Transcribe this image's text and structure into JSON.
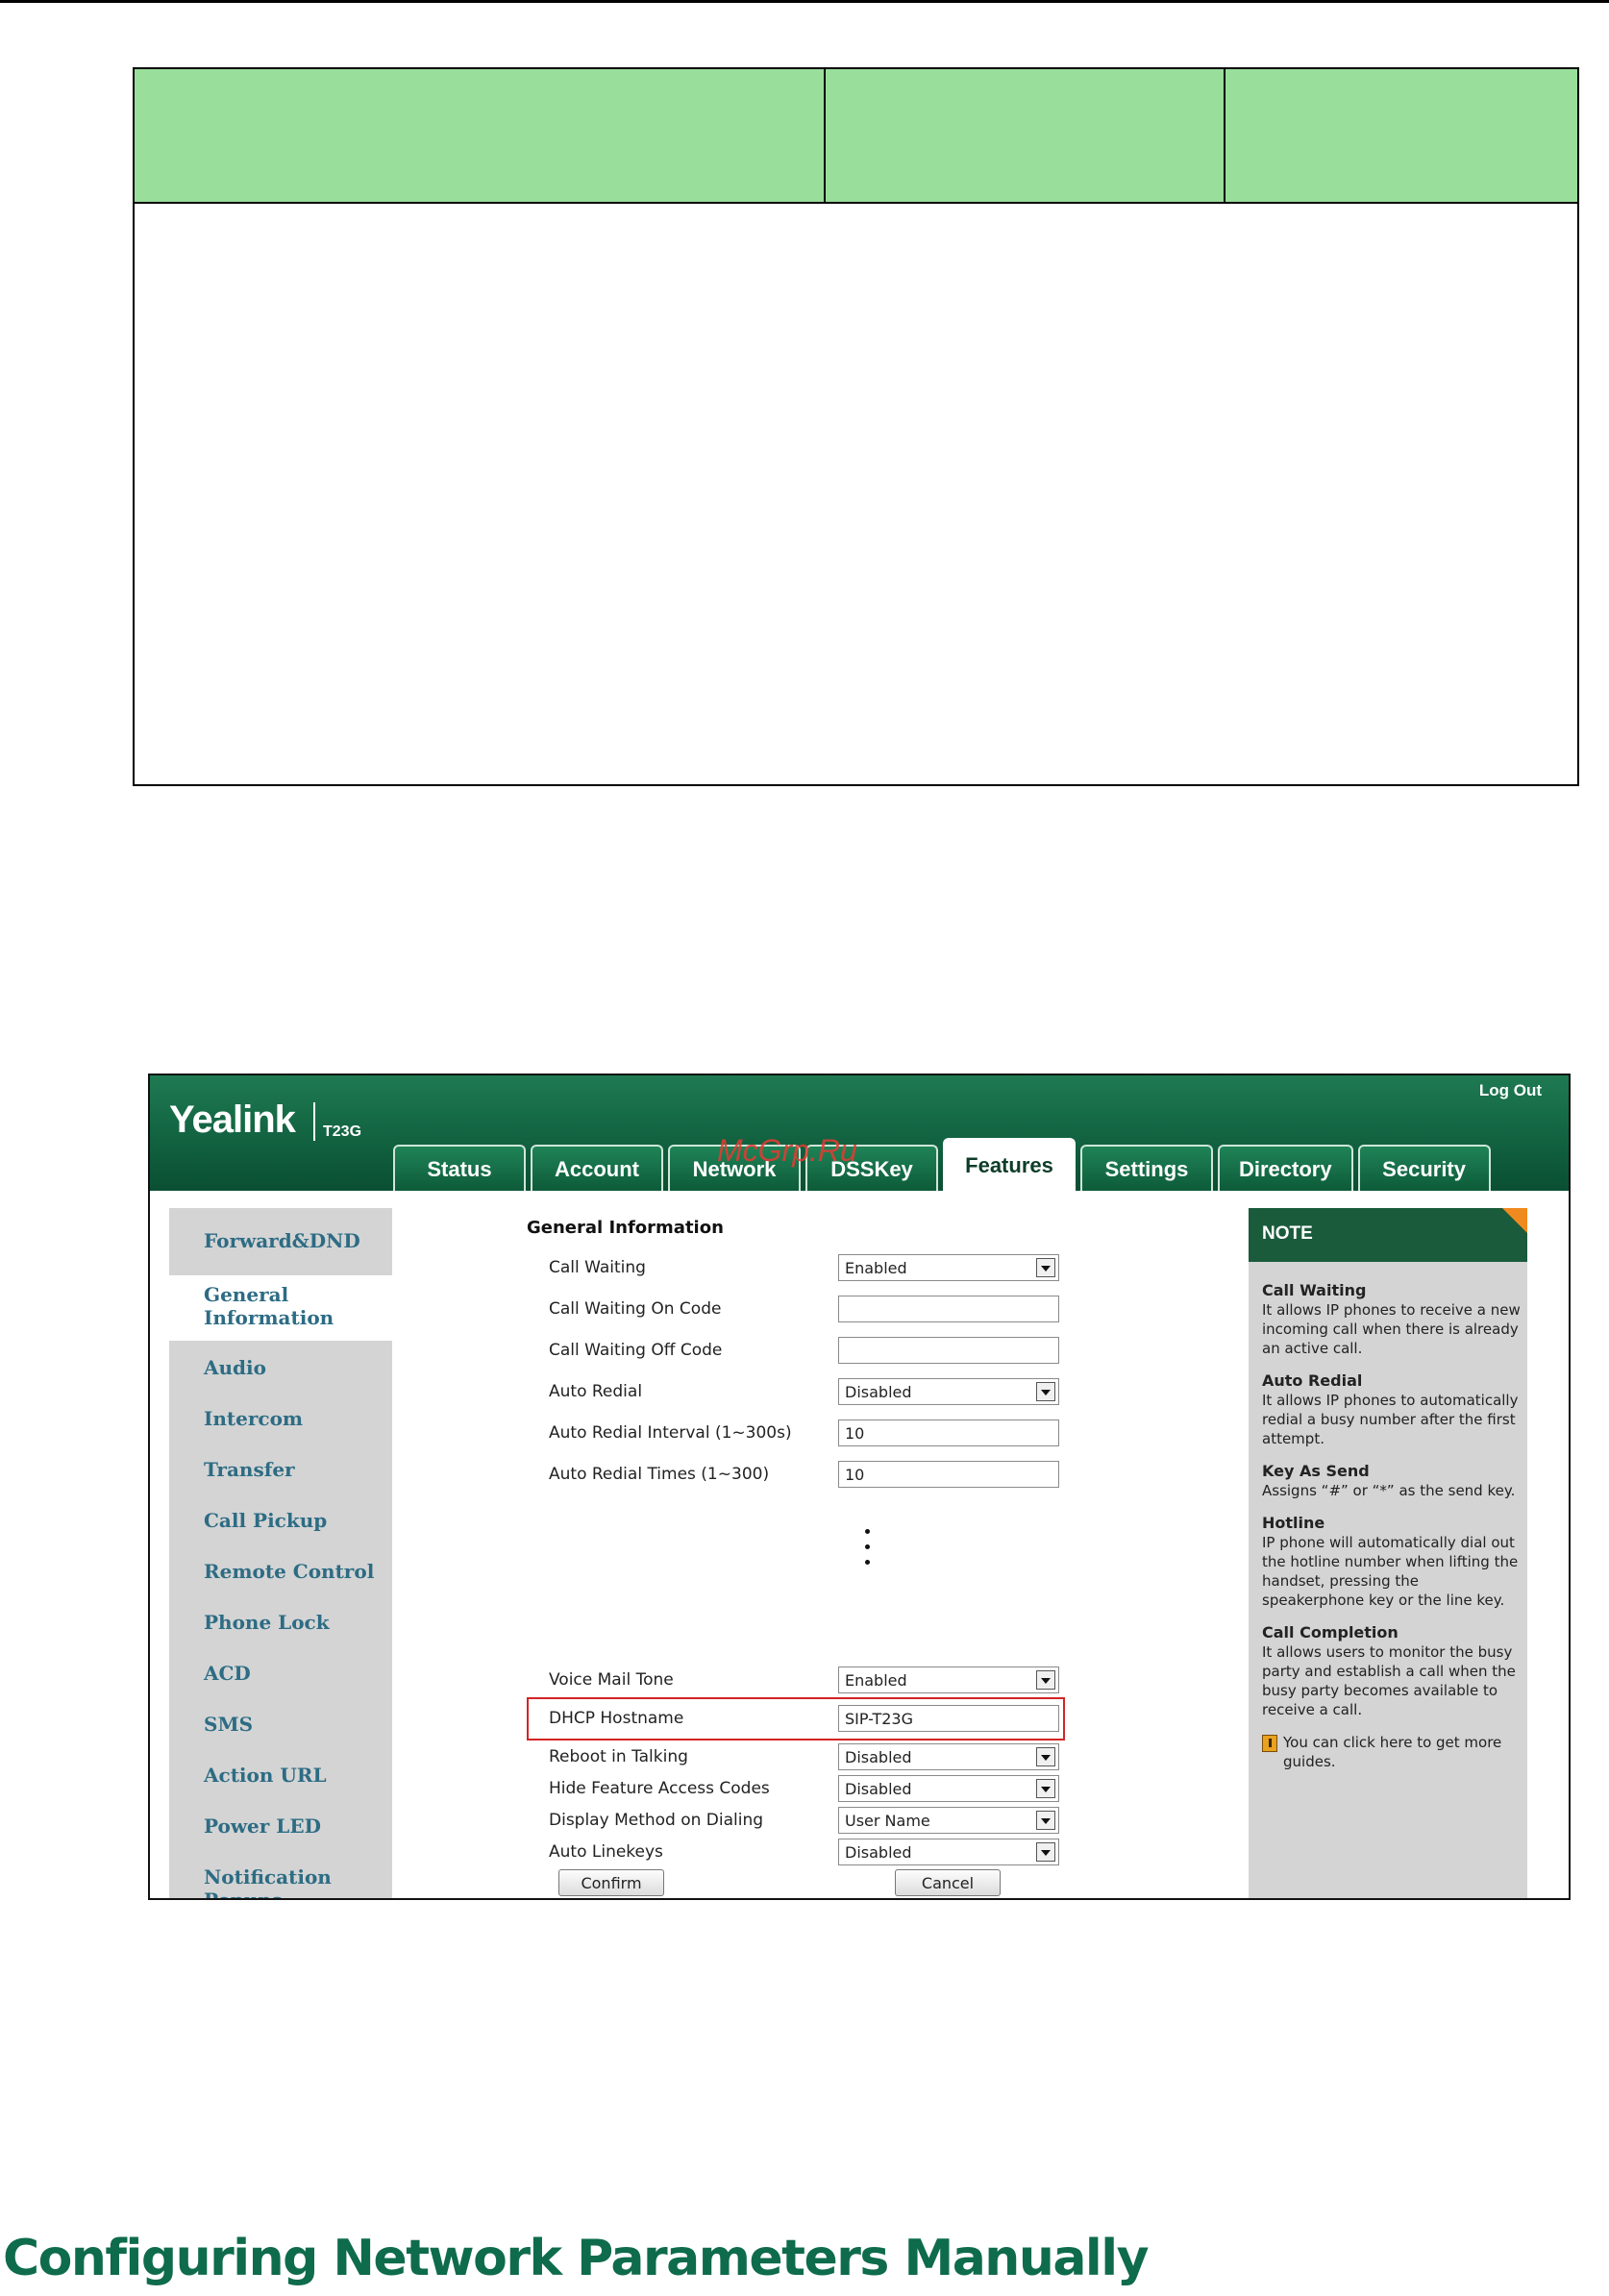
{
  "param_table": {
    "headers": [
      "",
      "",
      ""
    ]
  },
  "webui": {
    "logo": {
      "brand": "Yealink",
      "model": "T23G"
    },
    "logout_label": "Log Out",
    "watermark": "McGrp.Ru",
    "tabs": [
      "Status",
      "Account",
      "Network",
      "DSSKey",
      "Features",
      "Settings",
      "Directory",
      "Security"
    ],
    "active_tab": "Features",
    "sidebar": [
      "Forward&DND",
      "General Information",
      "Audio",
      "Intercom",
      "Transfer",
      "Call Pickup",
      "Remote Control",
      "Phone Lock",
      "ACD",
      "SMS",
      "Action URL",
      "Power LED",
      "Notification Popups"
    ],
    "active_sidebar": "General Information",
    "form": {
      "section_title": "General Information",
      "rows_top": [
        {
          "label": "Call Waiting",
          "type": "select",
          "value": "Enabled"
        },
        {
          "label": "Call Waiting On Code",
          "type": "input",
          "value": ""
        },
        {
          "label": "Call Waiting Off Code",
          "type": "input",
          "value": ""
        },
        {
          "label": "Auto Redial",
          "type": "select",
          "value": "Disabled"
        },
        {
          "label": "Auto Redial Interval (1~300s)",
          "type": "input",
          "value": "10"
        },
        {
          "label": "Auto Redial Times (1~300)",
          "type": "input",
          "value": "10"
        }
      ],
      "rows_bottom": [
        {
          "label": "Voice Mail Tone",
          "type": "select",
          "value": "Enabled"
        },
        {
          "label": "DHCP Hostname",
          "type": "input",
          "value": "SIP-T23G"
        },
        {
          "label": "Reboot in Talking",
          "type": "select",
          "value": "Disabled"
        },
        {
          "label": "Hide Feature Access Codes",
          "type": "select",
          "value": "Disabled"
        },
        {
          "label": "Display Method on Dialing",
          "type": "select",
          "value": "User Name"
        },
        {
          "label": "Auto Linekeys",
          "type": "select",
          "value": "Disabled"
        }
      ],
      "confirm_label": "Confirm",
      "cancel_label": "Cancel"
    },
    "note": {
      "heading": "NOTE",
      "items": [
        {
          "title": "Call Waiting",
          "text": "It allows IP phones to receive a new incoming call when there is already an active call."
        },
        {
          "title": "Auto Redial",
          "text": "It allows IP phones to automatically redial a busy number after the first attempt."
        },
        {
          "title": "Key As Send",
          "text": "Assigns “#” or “*” as the send key."
        },
        {
          "title": "Hotline",
          "text": "IP phone will automatically dial out the hotline number when lifting the handset, pressing the speakerphone key or the line key."
        },
        {
          "title": "Call Completion",
          "text": "It allows users to monitor the busy party and establish a call when the busy party becomes available to receive a call."
        }
      ],
      "guide_text": "You can click here to get more guides."
    }
  },
  "section_heading": "Configuring Network Parameters Manually"
}
